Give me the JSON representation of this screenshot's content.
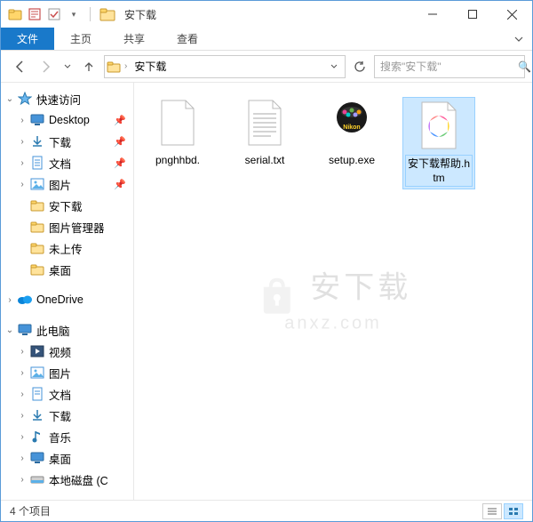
{
  "window": {
    "title": "安下载"
  },
  "ribbon": {
    "file": "文件",
    "tabs": [
      "主页",
      "共享",
      "查看"
    ]
  },
  "address": {
    "crumbs": [
      "安下载"
    ]
  },
  "search": {
    "placeholder": "搜索\"安下载\""
  },
  "sidebar": {
    "quick_access": "快速访问",
    "items": [
      {
        "label": "Desktop",
        "pinned": true
      },
      {
        "label": "下载",
        "pinned": true
      },
      {
        "label": "文档",
        "pinned": true
      },
      {
        "label": "图片",
        "pinned": true
      },
      {
        "label": "安下载",
        "pinned": false
      },
      {
        "label": "图片管理器",
        "pinned": false
      },
      {
        "label": "未上传",
        "pinned": false
      },
      {
        "label": "桌面",
        "pinned": false
      }
    ],
    "onedrive": "OneDrive",
    "this_pc": "此电脑",
    "pc_items": [
      {
        "label": "视频"
      },
      {
        "label": "图片"
      },
      {
        "label": "文档"
      },
      {
        "label": "下载"
      },
      {
        "label": "音乐"
      },
      {
        "label": "桌面"
      },
      {
        "label": "本地磁盘 (C"
      }
    ]
  },
  "files": [
    {
      "name": "pnghhbd."
    },
    {
      "name": "serial.txt"
    },
    {
      "name": "setup.exe"
    },
    {
      "name": "安下载帮助.htm"
    }
  ],
  "statusbar": {
    "count": "4 个项目"
  },
  "watermark": {
    "text": "安下载",
    "sub": "anxz.com"
  }
}
